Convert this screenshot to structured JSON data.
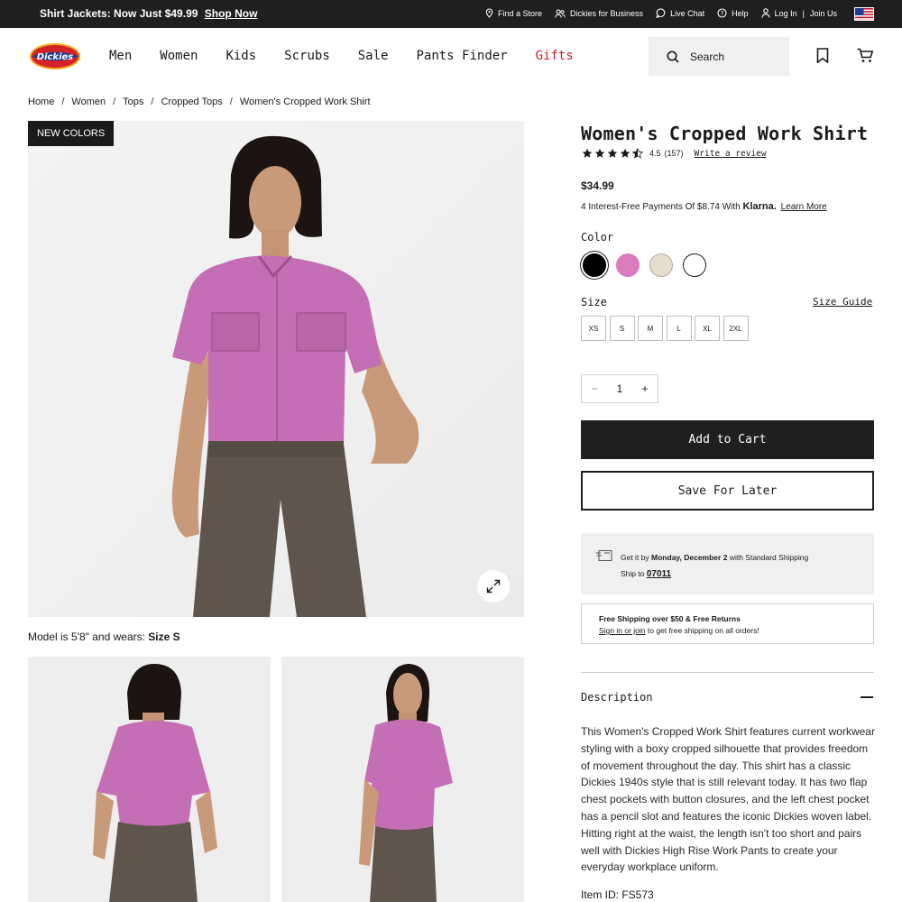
{
  "promo": {
    "text": "Shirt Jackets: Now Just $49.99",
    "link": "Shop Now"
  },
  "utility": {
    "find_store": "Find a Store",
    "business": "Dickies for Business",
    "live_chat": "Live Chat",
    "help": "Help",
    "login": "Log In",
    "separator": "|",
    "join": "Join Us"
  },
  "nav": {
    "items": [
      "Men",
      "Women",
      "Kids",
      "Scrubs",
      "Sale",
      "Pants Finder",
      "Gifts"
    ],
    "gifts_color": "#d2232a"
  },
  "search": {
    "label": "Search"
  },
  "breadcrumb": [
    "Home",
    "Women",
    "Tops",
    "Cropped Tops",
    "Women's Cropped Work Shirt"
  ],
  "gallery": {
    "badge": "NEW COLORS",
    "model_note": "Model is 5'8\" and wears:",
    "model_size": "Size S"
  },
  "product": {
    "title": "Women's Cropped Work Shirt",
    "rating": "4.5",
    "reviews": "(157)",
    "write_review": "Write a review",
    "price": "$34.99",
    "klarna_prefix": "4 Interest-Free Payments Of $8.74 With",
    "klarna_brand": "Klarna.",
    "klarna_link": "Learn More",
    "color_label": "Color",
    "colors": [
      "#000000",
      "#d97cbd",
      "#e8dccf",
      "#ffffff"
    ],
    "size_label": "Size",
    "size_guide": "Size Guide",
    "sizes": [
      "XS",
      "S",
      "M",
      "L",
      "XL",
      "2XL"
    ],
    "quantity": "1",
    "qty_minus": "−",
    "qty_plus": "+",
    "add_to_cart": "Add to Cart",
    "save_for_later": "Save For Later"
  },
  "shipping": {
    "get_it_by": "Get it by",
    "date": "Monday, December 2",
    "method": "with Standard Shipping",
    "ship_to": "Ship to",
    "zip": "07011",
    "free_title": "Free Shipping over $50 & Free Returns",
    "signin": "Sign in or join",
    "signin_rest": "to get free shipping on all orders!"
  },
  "description": {
    "heading": "Description",
    "body": "This Women's Cropped Work Shirt features current workwear styling with a boxy cropped silhouette that provides freedom of movement throughout the day. This shirt has a classic Dickies 1940s style that is still relevant today. It has two flap chest pockets with button closures, and the left chest pocket has a pencil slot and features the iconic Dickies woven label. Hitting right at the waist, the length isn't too short and pairs well with Dickies High Rise Work Pants to create your everyday workplace uniform.",
    "item_id": "Item ID: FS573"
  }
}
